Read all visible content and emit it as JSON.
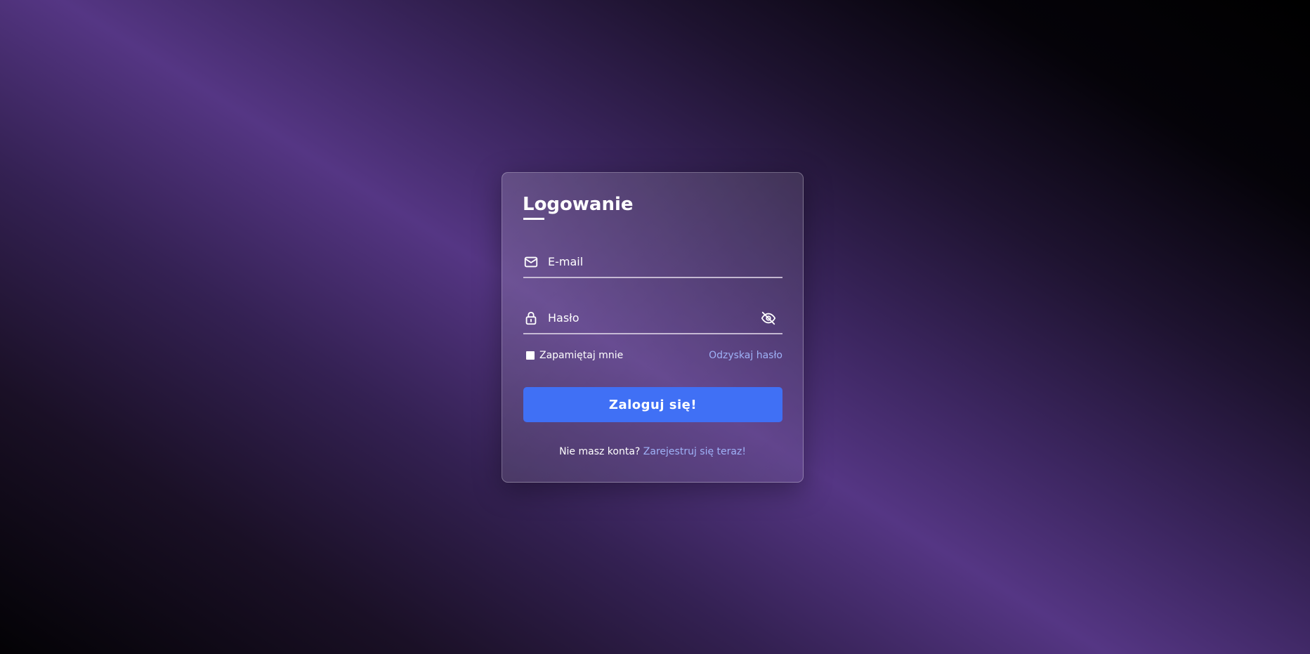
{
  "login": {
    "title": "Logowanie",
    "email": {
      "placeholder": "E-mail",
      "icon": "mail-icon"
    },
    "password": {
      "placeholder": "Hasło",
      "icon": "lock-icon",
      "toggle_icon": "eye-off-icon"
    },
    "remember_label": "Zapamiętaj mnie",
    "remember_checked": false,
    "forgot_label": "Odzyskaj hasło",
    "submit_label": "Zaloguj się!",
    "signup_prompt": "Nie masz konta?",
    "signup_link": "Zarejestruj się teraz!"
  },
  "colors": {
    "accent": "#4070f5",
    "link": "#9fb2f7",
    "background_purple": "#553684"
  }
}
